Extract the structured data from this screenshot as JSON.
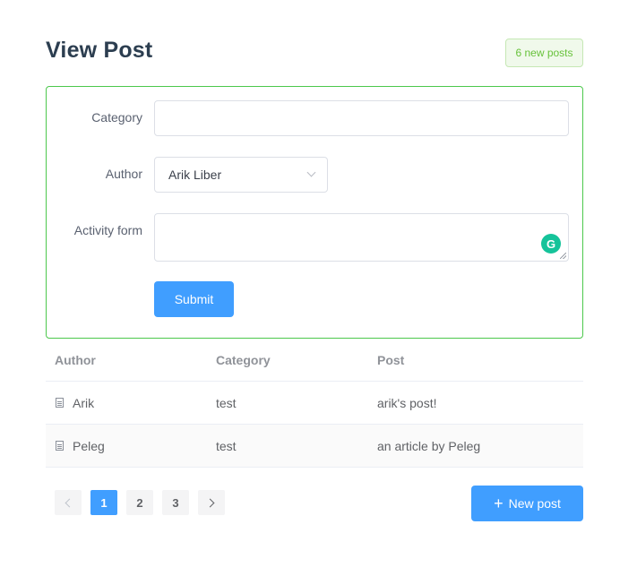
{
  "page": {
    "title": "View Post",
    "badge": "6 new posts"
  },
  "form": {
    "category_label": "Category",
    "category_value": "",
    "author_label": "Author",
    "author_selected": "Arik Liber",
    "activity_label": "Activity form",
    "activity_value": "",
    "grammarly_icon": "G",
    "submit_label": "Submit"
  },
  "table": {
    "headers": [
      "Author",
      "Category",
      "Post"
    ],
    "rows": [
      {
        "author": "Arik",
        "category": "test",
        "post": "arik's post!"
      },
      {
        "author": "Peleg",
        "category": "test",
        "post": "an article by Peleg"
      }
    ]
  },
  "pagination": {
    "pages": [
      "1",
      "2",
      "3"
    ],
    "current": "1"
  },
  "new_post": {
    "icon": "+",
    "label": "New post"
  },
  "colors": {
    "accent": "#409eff",
    "success": "#67c23a",
    "border_highlight": "#4cc84c"
  }
}
